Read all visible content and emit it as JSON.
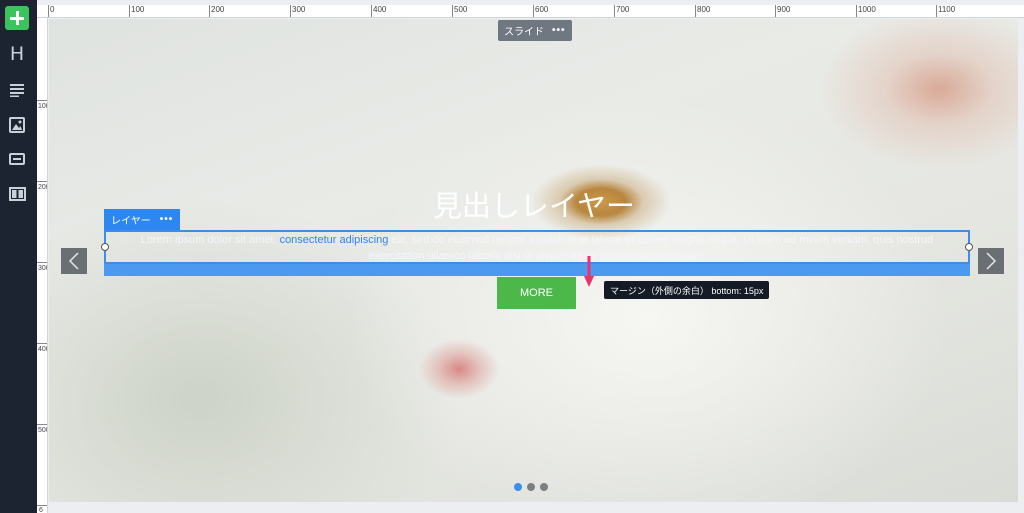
{
  "ruler": {
    "top_labels": [
      "0",
      "100",
      "200",
      "300",
      "400",
      "500",
      "600",
      "700",
      "800",
      "900",
      "1000",
      "1100"
    ],
    "left_labels": [
      "100",
      "200",
      "300",
      "400",
      "500",
      "6"
    ]
  },
  "slide": {
    "label": "スライド",
    "menu": "•••",
    "heading": "見出しレイヤー",
    "layer_label": "レイヤー",
    "layer_menu": "•••",
    "paragraph_before_link": "Lorem ipsum dolor sit amet, ",
    "paragraph_link": "consectetur adipiscing",
    "paragraph_after_link": " elit, sed do eiusmod tempor incididunt ut labore et dolore magna aliqua. Ut enim ad minim veniam, quis nostrud exercitation ullamco laboris nisi ut aliquip ex ea commodo consequat.",
    "tooltip": "マージン（外側の余白） bottom: 15px",
    "button": "MORE",
    "pagination": {
      "total": 3,
      "active": 1
    }
  },
  "colors": {
    "toolbar_bg": "#1b2430",
    "add_button": "#3dc35d",
    "selection": "#2e86f0",
    "more_button": "#4cb84a",
    "margin_arrow": "#e8336f"
  },
  "icons": [
    "add-icon",
    "heading-icon",
    "text-icon",
    "image-icon",
    "button-icon",
    "columns-icon",
    "chevron-left-icon",
    "chevron-right-icon"
  ]
}
